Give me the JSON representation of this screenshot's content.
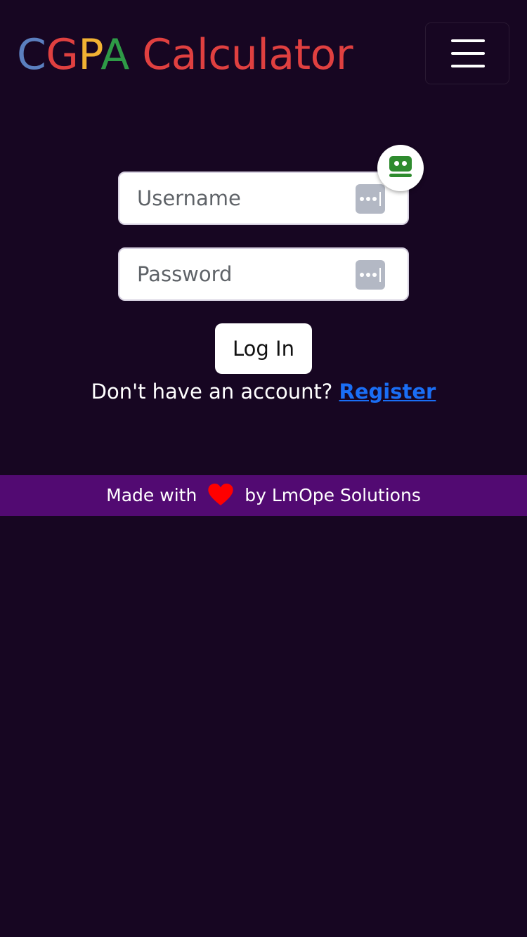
{
  "brand": {
    "letters": [
      {
        "char": "C",
        "color": "#5b7fbf"
      },
      {
        "char": "G",
        "color": "#e04040"
      },
      {
        "char": "P",
        "color": "#f2b233"
      },
      {
        "char": "A",
        "color": "#2e9a46"
      }
    ],
    "rest": " Calculator",
    "rest_color": "#e04040"
  },
  "nav": {
    "toggle_icon": "hamburger-menu-icon"
  },
  "login_form": {
    "username_placeholder": "Username",
    "password_placeholder": "Password",
    "password_manager_icon": "password-dots-icon",
    "extension_badge_icon": "roboform-robot-icon",
    "submit_label": "Log In"
  },
  "register": {
    "prompt": "Don't have an account?",
    "link_label": "Register",
    "link_color": "#1a6ef5"
  },
  "footer": {
    "before": "Made with",
    "heart_icon": "heart-icon",
    "heart_color": "#ff0000",
    "after": "by LmOpe Solutions",
    "background": "#520a72"
  },
  "colors": {
    "page_background": "#170622"
  }
}
